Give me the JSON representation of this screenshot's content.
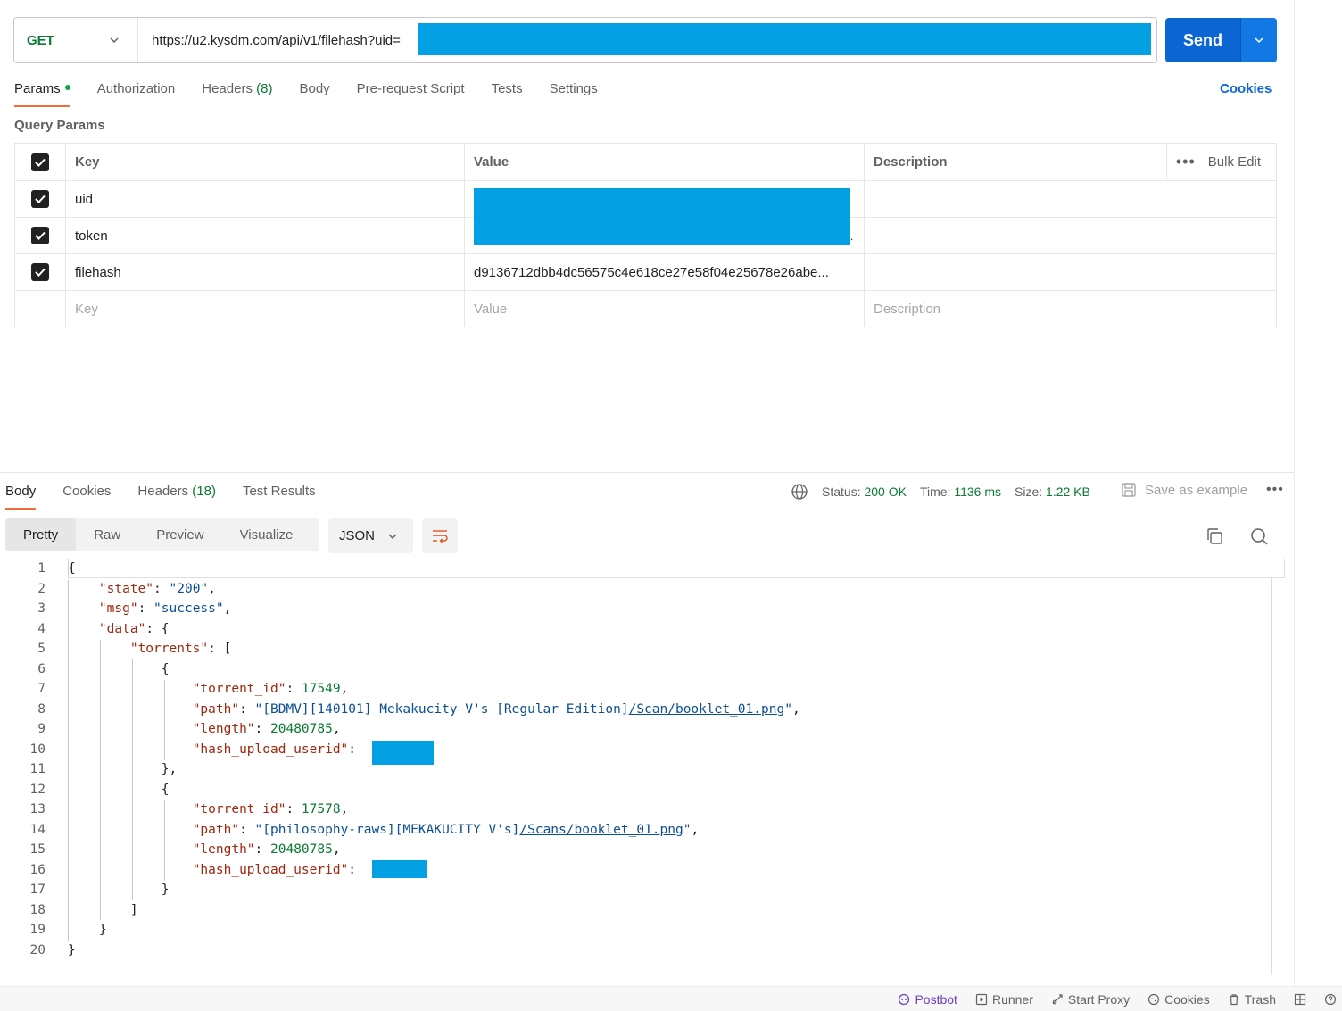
{
  "request": {
    "method": "GET",
    "url": "https://u2.kysdm.com/api/v1/filehash?uid=",
    "send_label": "Send"
  },
  "req_tabs": {
    "params": "Params",
    "authorization": "Authorization",
    "headers": "Headers",
    "headers_count": "(8)",
    "body": "Body",
    "prerequest": "Pre-request Script",
    "tests": "Tests",
    "settings": "Settings",
    "cookies": "Cookies"
  },
  "query_params": {
    "title": "Query Params",
    "headers": {
      "key": "Key",
      "value": "Value",
      "description": "Description",
      "bulk_edit": "Bulk Edit"
    },
    "rows": [
      {
        "key": "uid",
        "value": "",
        "checked": true
      },
      {
        "key": "token",
        "value": ".",
        "checked": true
      },
      {
        "key": "filehash",
        "value": "d9136712dbb4dc56575c4e618ce27e58f04e25678e26abe...",
        "checked": true
      }
    ],
    "placeholders": {
      "key": "Key",
      "value": "Value",
      "description": "Description"
    }
  },
  "response": {
    "tabs": {
      "body": "Body",
      "cookies": "Cookies",
      "headers": "Headers",
      "headers_count": "(18)",
      "test_results": "Test Results"
    },
    "status_label": "Status:",
    "status_value": "200 OK",
    "time_label": "Time:",
    "time_value": "1136 ms",
    "size_label": "Size:",
    "size_value": "1.22 KB",
    "save_example": "Save as example",
    "views": {
      "pretty": "Pretty",
      "raw": "Raw",
      "preview": "Preview",
      "visualize": "Visualize"
    },
    "format": "JSON"
  },
  "code": {
    "line_numbers": [
      "1",
      "2",
      "3",
      "4",
      "5",
      "6",
      "7",
      "8",
      "9",
      "10",
      "11",
      "12",
      "13",
      "14",
      "15",
      "16",
      "17",
      "18",
      "19",
      "20"
    ],
    "state_value": "\"200\"",
    "msg_value": "\"success\"",
    "t1_id": "17549",
    "t1_path_a": "[BDMV][140101] Mekakucity V's [Regular Edition]",
    "t1_path_b": "/Scan/booklet_01.png",
    "t1_length": "20480785",
    "t2_id": "17578",
    "t2_path_a": "[philosophy-raws][MEKAKUCITY V's]",
    "t2_path_b": "/Scans/booklet_01.png",
    "t2_length": "20480785"
  },
  "footer": {
    "postbot": "Postbot",
    "runner": "Runner",
    "start_proxy": "Start Proxy",
    "cookies": "Cookies",
    "trash": "Trash"
  },
  "colors": {
    "send": "#0b66d4",
    "accent_tab": "#f26b3a",
    "status_green": "#0b7a33",
    "redaction": "#03a0e4"
  }
}
